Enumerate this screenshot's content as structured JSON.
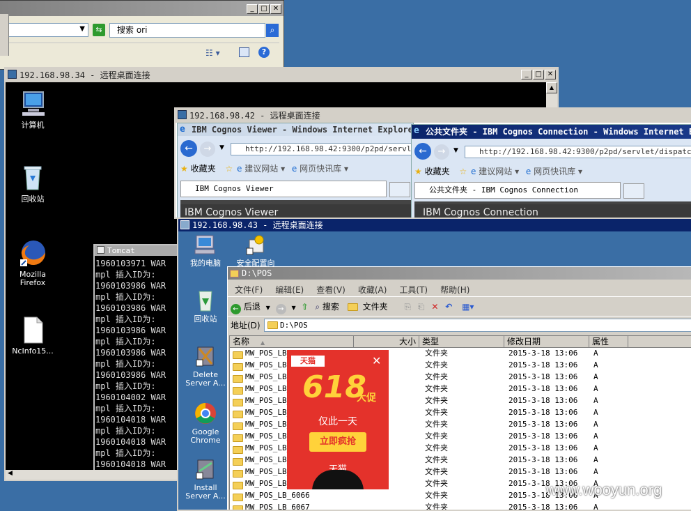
{
  "explorer_top": {
    "search_placeholder": "搜索 ori",
    "buttons": [
      "close"
    ]
  },
  "rdp34": {
    "title": "192.168.98.34 - 远程桌面连接",
    "desktop_icons": [
      "计算机",
      "回收站",
      "Mozilla Firefox",
      "NcInfo15..."
    ],
    "tomcat": {
      "title": "Tomcat",
      "lines": [
        "1960103971 WAR",
        "mpl 插入ID为:",
        "1960103986 WAR",
        "mpl 插入ID为:",
        "1960103986 WAR",
        "mpl 插入ID为:",
        "1960103986 WAR",
        "mpl 插入ID为:",
        "1960103986 WAR",
        "mpl 插入ID为:",
        "1960103986 WAR",
        "mpl 插入ID为:",
        "1960104002 WAR",
        "mpl 插入ID为:",
        "1960104018 WAR",
        "mpl 插入ID为:",
        "1960104018 WAR",
        "mpl 插入ID为:",
        "1960104018 WAR"
      ]
    }
  },
  "rdp42": {
    "title": "192.168.98.42 - 远程桌面连接",
    "ie_left": {
      "title": "IBM Cognos Viewer - Windows Internet Explorer",
      "url": "http://192.168.98.42:9300/p2pd/servlet/",
      "favorites": "收藏夹",
      "fav1": "建议网站 ▾",
      "fav2": "网页快讯库 ▾",
      "tab": "IBM Cognos Viewer",
      "content_heading": "IBM Cognos Viewer"
    },
    "ie_right": {
      "title": "公共文件夹 - IBM Cognos Connection - Windows Internet Ex",
      "url": "http://192.168.98.42:9300/p2pd/servlet/dispatch?b_",
      "favorites": "收藏夹",
      "fav1": "建议网站 ▾",
      "fav2": "网页快讯库 ▾",
      "tab": "公共文件夹 - IBM Cognos Connection",
      "content_heading": "IBM Cognos Connection"
    }
  },
  "rdp43": {
    "title": "192.168.98.43 - 远程桌面连接",
    "desktop_icons": [
      "我的电脑",
      "安全配置向",
      "回收站",
      "Delete Server A...",
      "Google Chrome",
      "Install Server A..."
    ],
    "explorer": {
      "title": "D:\\POS",
      "menu": [
        "文件(F)",
        "编辑(E)",
        "查看(V)",
        "收藏(A)",
        "工具(T)",
        "帮助(H)"
      ],
      "toolbar": {
        "back": "后退",
        "search": "搜索",
        "folders": "文件夹"
      },
      "address_label": "地址(D)",
      "address_value": "D:\\POS",
      "columns": [
        "名称",
        "大小",
        "类型",
        "修改日期",
        "属性"
      ],
      "rows": [
        {
          "name": "MW_POS_LB_6054",
          "type": "文件夹",
          "date": "2015-3-18 13:06",
          "attr": "A"
        },
        {
          "name": "MW_POS_LB_",
          "type": "文件夹",
          "date": "2015-3-18 13:06",
          "attr": "A"
        },
        {
          "name": "MW_POS_LB_",
          "type": "文件夹",
          "date": "2015-3-18 13:06",
          "attr": "A"
        },
        {
          "name": "MW_POS_LB_",
          "type": "文件夹",
          "date": "2015-3-18 13:06",
          "attr": "A"
        },
        {
          "name": "MW_POS_LB_",
          "type": "文件夹",
          "date": "2015-3-18 13:06",
          "attr": "A"
        },
        {
          "name": "MW_POS_LB_",
          "type": "文件夹",
          "date": "2015-3-18 13:06",
          "attr": "A"
        },
        {
          "name": "MW_POS_LB_",
          "type": "文件夹",
          "date": "2015-3-18 13:06",
          "attr": "A"
        },
        {
          "name": "MW_POS_LB_",
          "type": "文件夹",
          "date": "2015-3-18 13:06",
          "attr": "A"
        },
        {
          "name": "MW_POS_LB_",
          "type": "文件夹",
          "date": "2015-3-18 13:06",
          "attr": "A"
        },
        {
          "name": "MW_POS_LB_",
          "type": "文件夹",
          "date": "2015-3-18 13:06",
          "attr": "A"
        },
        {
          "name": "MW_POS_LB_",
          "type": "文件夹",
          "date": "2015-3-18 13:06",
          "attr": "A"
        },
        {
          "name": "MW_POS_LB_",
          "type": "文件夹",
          "date": "2015-3-18 13:06",
          "attr": "A"
        },
        {
          "name": "MW_POS_LB_6066",
          "type": "文件夹",
          "date": "2015-3-18 13:06",
          "attr": "A"
        },
        {
          "name": "MW_POS_LB_6067",
          "type": "文件夹",
          "date": "2015-3-18 13:06",
          "attr": "A"
        }
      ]
    },
    "ad": {
      "brand": "天猫",
      "headline": "618",
      "sub": "大促",
      "tagline": "仅此一天",
      "cta": "立即疯抢",
      "footer": "天猫"
    }
  },
  "watermark": "www.wooyun.org"
}
